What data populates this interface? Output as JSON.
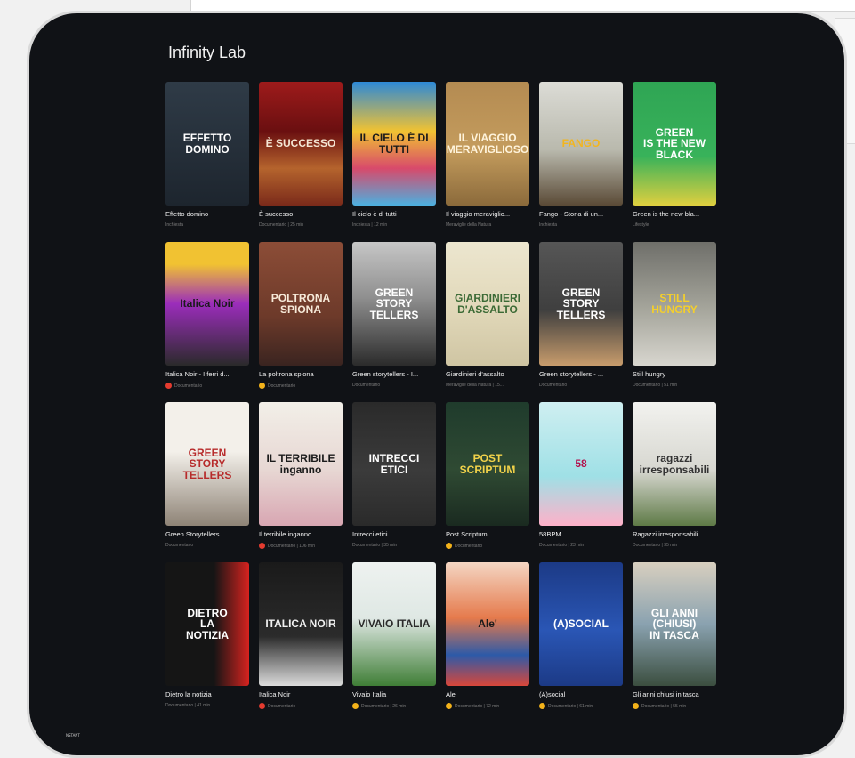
{
  "page_title": "Infinity Lab",
  "watermark": "NSTANT",
  "rows": [
    [
      {
        "title": "Effetto domino",
        "meta": "Inchiesta",
        "dot": "",
        "poster": "EFFETTO\nDOMINO",
        "bg": "linear-gradient(180deg,#2f3b47,#1d252e)",
        "fg": "#ffffff"
      },
      {
        "title": "È successo",
        "meta": "Documentario | 25 min",
        "dot": "",
        "poster": "È SUCCESSO",
        "bg": "linear-gradient(180deg,#9e1b1b,#6a0f10 40%,#b5642d 70%,#7a2a1a)",
        "fg": "#f5e7d4"
      },
      {
        "title": "Il cielo è di tutti",
        "meta": "Inchiesta | 12 min",
        "dot": "",
        "poster": "IL CIELO È DI TUTTI",
        "bg": "linear-gradient(180deg,#2e89d6,#f1c232 40%,#d84a6b 70%,#4bb0e0)",
        "fg": "#1b1b1b"
      },
      {
        "title": "Il viaggio meraviglio...",
        "meta": "Meraviglie della Natura",
        "dot": "",
        "poster": "IL VIAGGIO\nMERAVIGLIOSO",
        "bg": "linear-gradient(180deg,#b48b52,#c49c5d 55%,#8b6a3b)",
        "fg": "#fff4dc"
      },
      {
        "title": "Fango - Storia di un...",
        "meta": "Inchiesta",
        "dot": "",
        "poster": "FANGO",
        "bg": "linear-gradient(180deg,#dcdcd6,#b9b9ad 55%,#5a4a36)",
        "fg": "#f2b51f"
      },
      {
        "title": "Green is the new bla...",
        "meta": "Lifestyle",
        "dot": "",
        "poster": "GREEN\nIS THE NEW\nBLACK",
        "bg": "linear-gradient(180deg,#2fa554,#38b25a 60%,#e0cf3f)",
        "fg": "#ffffff"
      }
    ],
    [
      {
        "title": "Italica Noir - I ferri d...",
        "meta": "Documentario",
        "dot": "red",
        "poster": "Italica Noir",
        "bg": "linear-gradient(180deg,#f1c232,#f1c232 18%,#9b2dbb 50%,#2a2a2a)",
        "fg": "#1b1b1b"
      },
      {
        "title": "La poltrona spiona",
        "meta": "Documentario",
        "dot": "orange",
        "poster": "POLTRONA\nSPIONA",
        "bg": "linear-gradient(180deg,#8c4d37,#6d3a2a 60%,#3a2420)",
        "fg": "#f7ead9"
      },
      {
        "title": "Green storytellers - I...",
        "meta": "Documentario",
        "dot": "",
        "poster": "GREEN\nSTORY\nTELLERS",
        "bg": "linear-gradient(180deg,#c6c6c6,#8f8f8f 45%,#2b2b2b)",
        "fg": "#ffffff"
      },
      {
        "title": "Giardinieri d'assalto",
        "meta": "Meraviglie della Natura | 15...",
        "dot": "",
        "poster": "GIARDINIERI\nD'ASSALTO",
        "bg": "linear-gradient(180deg,#ece6cf,#e1d8b9 55%,#cfc5a3)",
        "fg": "#3b6a35"
      },
      {
        "title": "Green storytellers - ...",
        "meta": "Documentario",
        "dot": "",
        "poster": "GREEN\nSTORY\nTELLERS",
        "bg": "linear-gradient(180deg,#565656,#3f3f3f 55%,#c89c6c)",
        "fg": "#ffffff"
      },
      {
        "title": "Still hungry",
        "meta": "Documentario | 51 min",
        "dot": "",
        "poster": "STILL\nHUNGRY",
        "bg": "linear-gradient(180deg,#6f6f6a,#a6a69c 55%,#d8d6cf)",
        "fg": "#f4cf2c"
      }
    ],
    [
      {
        "title": "Green Storytellers",
        "meta": "Documentario",
        "dot": "",
        "poster": "GREEN\nSTORY\nTELLERS",
        "bg": "linear-gradient(180deg,#f3f0ea,#f3f0ea 40%,#8e8376)",
        "fg": "#b72b2b"
      },
      {
        "title": "Il terribile inganno",
        "meta": "Documentario | 106 min",
        "dot": "red",
        "poster": "IL TERRIBILE\ninganno",
        "bg": "linear-gradient(180deg,#f2efe8,#e7d7d3 55%,#d8a6b2)",
        "fg": "#1b1b1b"
      },
      {
        "title": "Intrecci etici",
        "meta": "Documentario | 35 min",
        "dot": "",
        "poster": "INTRECCI\nETICI",
        "bg": "linear-gradient(180deg,#2a2a2a,#3b3b3b 55%,#2a2a2a)",
        "fg": "#ffffff"
      },
      {
        "title": "Post Scriptum",
        "meta": "Documentario",
        "dot": "orange",
        "poster": "POST\nSCRIPTUM",
        "bg": "linear-gradient(180deg,#1f3b2c,#2f4a33 55%,#1a2a20)",
        "fg": "#f3d34a"
      },
      {
        "title": "58BPM",
        "meta": "Documentario | 23 min",
        "dot": "",
        "poster": "58",
        "bg": "linear-gradient(180deg,#cfeff1,#9fe0e6 60%,#ffb1c9)",
        "fg": "#b3124d"
      },
      {
        "title": "Ragazzi irresponsabili",
        "meta": "Documentario | 35 min",
        "dot": "",
        "poster": "ragazzi\nirresponsabili",
        "bg": "linear-gradient(180deg,#f2f2ef,#d7d7d0 55%,#5e7a46)",
        "fg": "#333333"
      }
    ],
    [
      {
        "title": "Dietro la notizia",
        "meta": "Documentario | 41 min",
        "dot": "",
        "poster": "DIETRO\nLA\nNOTIZIA",
        "bg": "linear-gradient(90deg,#151515,#151515 58%,#d7231f)",
        "fg": "#ffffff"
      },
      {
        "title": "Italica Noir",
        "meta": "Documentario",
        "dot": "red",
        "poster": "ITALICA NOIR",
        "bg": "linear-gradient(180deg,#1a1a1a,#2b2b2b 60%,#dcdcdc)",
        "fg": "#f1f1f1"
      },
      {
        "title": "Vivaio Italia",
        "meta": "Documentario | 26 min",
        "dot": "orange",
        "poster": "VIVAIO ITALIA",
        "bg": "linear-gradient(180deg,#eef2f0,#dfe8e4 45%,#3f7e36)",
        "fg": "#2b2b2b"
      },
      {
        "title": "Ale'",
        "meta": "Documentario | 72 min",
        "dot": "orange",
        "poster": "Ale'",
        "bg": "linear-gradient(180deg,#f4d6c3,#e57a4c 45%,#2d5aa8 75%,#d8473a)",
        "fg": "#1b1b1b"
      },
      {
        "title": "(A)social",
        "meta": "Documentario | 61 min",
        "dot": "orange",
        "poster": "(A)SOCIAL",
        "bg": "linear-gradient(180deg,#1c3a86,#2a56b5 55%,#1c3a86)",
        "fg": "#ffffff"
      },
      {
        "title": "Gli anni chiusi in tasca",
        "meta": "Documentario | 55 min",
        "dot": "orange",
        "poster": "GLI ANNI\n(CHIUSI)\nIN TASCA",
        "bg": "linear-gradient(180deg,#d8cfbf,#8aa2b0 50%,#3b4e3f)",
        "fg": "#ffffff"
      }
    ]
  ]
}
